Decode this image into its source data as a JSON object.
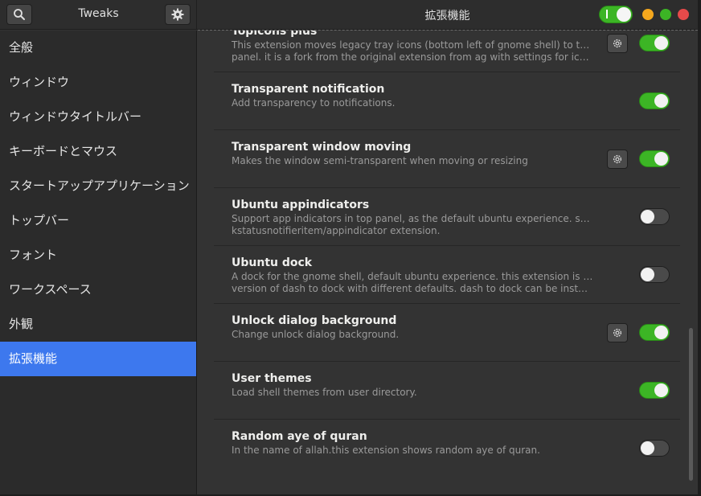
{
  "header": {
    "left_title": "Tweaks",
    "right_title": "拡張機能",
    "search_icon": "search-icon",
    "prefs_icon": "gear-icon",
    "global_extensions_switch": "on"
  },
  "window_controls": [
    "minimize",
    "maximize",
    "close"
  ],
  "sidebar": {
    "items": [
      {
        "label": "全般"
      },
      {
        "label": "ウィンドウ"
      },
      {
        "label": "ウィンドウタイトルバー"
      },
      {
        "label": "キーボードとマウス"
      },
      {
        "label": "スタートアップアプリケーション"
      },
      {
        "label": "トップバー"
      },
      {
        "label": "フォント"
      },
      {
        "label": "ワークスペース"
      },
      {
        "label": "外観"
      },
      {
        "label": "拡張機能"
      }
    ],
    "active": "拡張機能"
  },
  "extensions": [
    {
      "title": "Topicons plus",
      "desc1": "This extension moves legacy tray icons (bottom left of gnome shell) to the top",
      "desc2": "panel. it is a fork from the original extension from ag  with settings for icon op…",
      "has_settings": true,
      "enabled": true
    },
    {
      "title": "Transparent notification",
      "desc1": "Add transparency to notifications.",
      "desc2": "",
      "has_settings": false,
      "enabled": true
    },
    {
      "title": "Transparent window moving",
      "desc1": "Makes the window semi-transparent when moving or resizing",
      "desc2": "",
      "has_settings": true,
      "enabled": true
    },
    {
      "title": "Ubuntu appindicators",
      "desc1": "Support app indicators in top panel, as the default ubuntu experience. system update",
      "desc2": "kstatusnotifieritem/appindicator extension.",
      "has_settings": false,
      "enabled": false
    },
    {
      "title": "Ubuntu dock",
      "desc1": "A dock for the gnome shell, default ubuntu experience. this extension is a modified",
      "desc2": "version of dash to dock with different defaults. dash to dock can be installed to replac…",
      "has_settings": false,
      "enabled": false
    },
    {
      "title": "Unlock dialog background",
      "desc1": "Change unlock dialog background.",
      "desc2": "",
      "has_settings": true,
      "enabled": true
    },
    {
      "title": "User themes",
      "desc1": "Load shell themes from user directory.",
      "desc2": "",
      "has_settings": false,
      "enabled": true
    },
    {
      "title": "Random aye of quran",
      "desc1": "In the name of allah.this extension shows random aye of quran.",
      "desc2": "",
      "has_settings": false,
      "enabled": false
    }
  ],
  "colors": {
    "accent": "#3d78ee",
    "switch_on": "#3cb525",
    "minimize": "#f4a71d",
    "maximize": "#3cb525",
    "close": "#e64a4a"
  }
}
